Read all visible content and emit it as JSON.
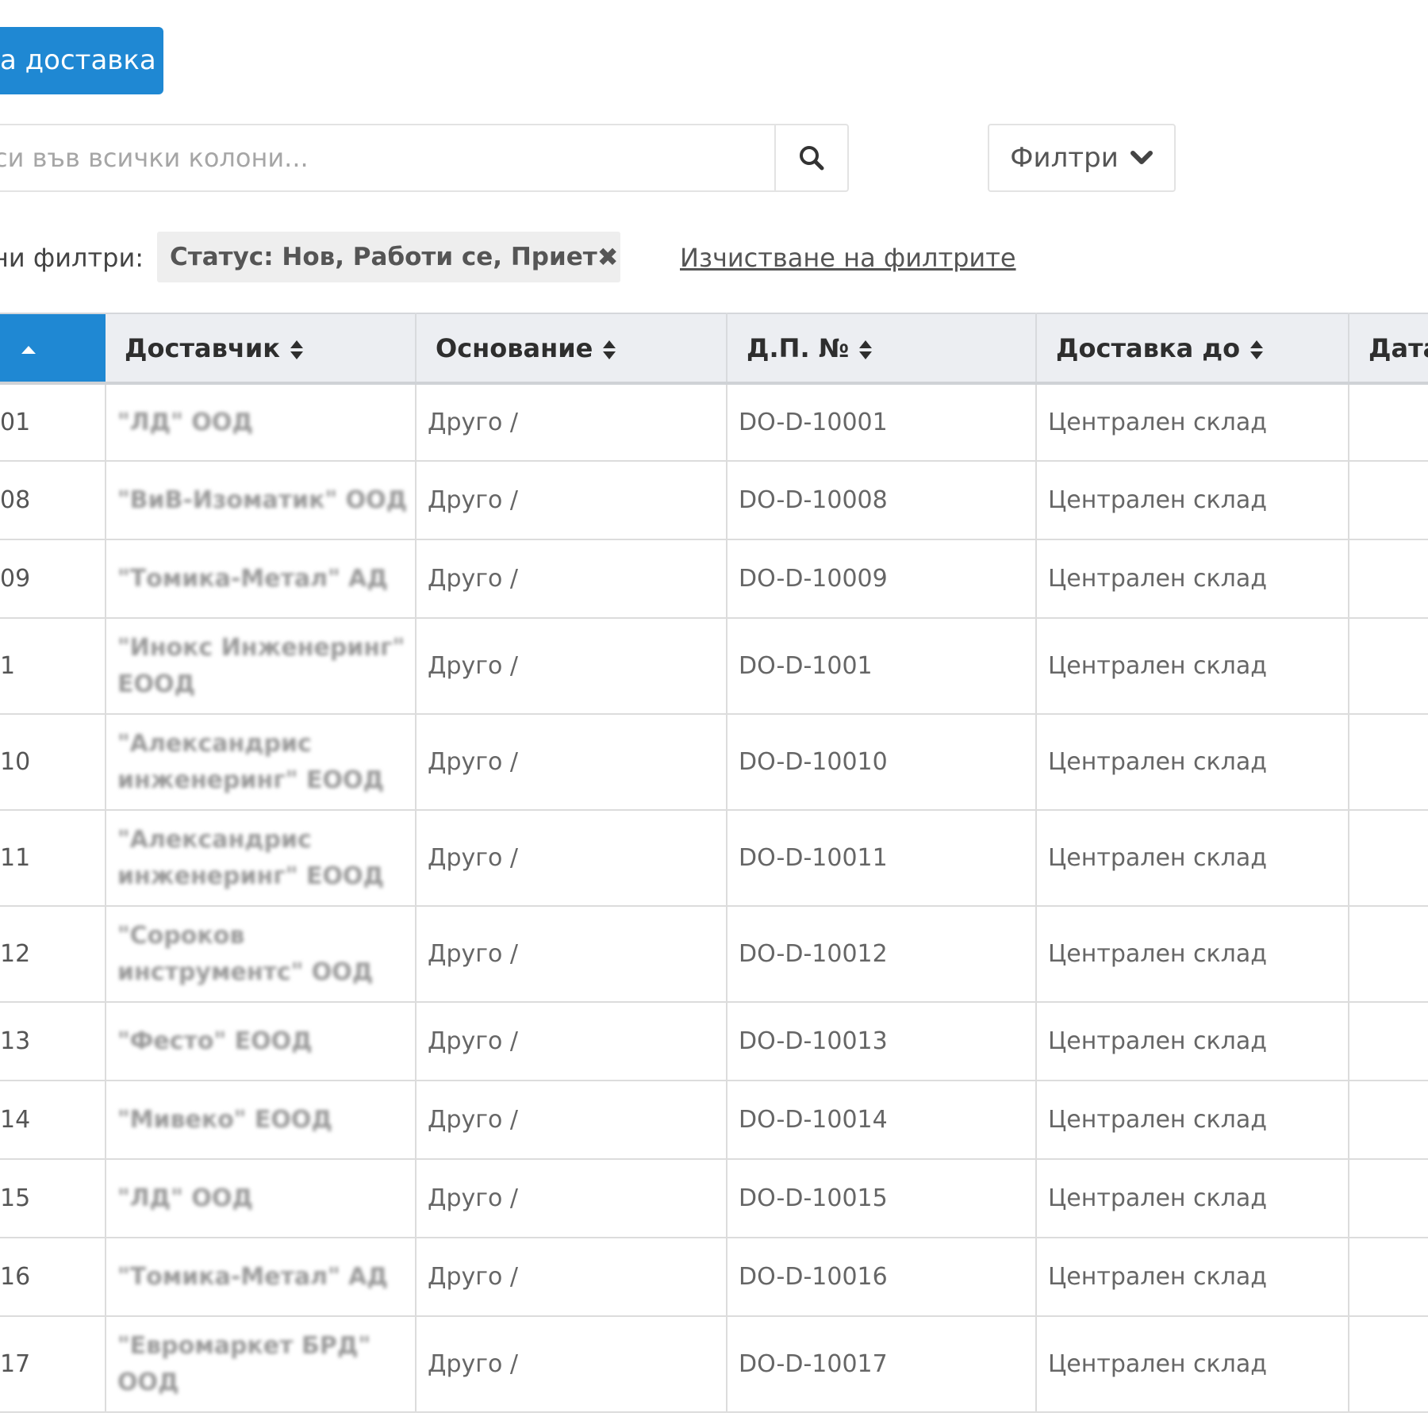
{
  "toolbar": {
    "new_delivery_label": "а доставка"
  },
  "search": {
    "placeholder": "си във всички колони..."
  },
  "filters": {
    "button_label": "Филтри",
    "active_label": "ни филтри:",
    "chip_label": "Статус: Нов, Работи се, Приет",
    "chip_close": "✖",
    "clear_label": "Изчистване на филтрите"
  },
  "table": {
    "columns": [
      {
        "label": "",
        "sorted": "asc"
      },
      {
        "label": "Доставчик"
      },
      {
        "label": "Основание"
      },
      {
        "label": "Д.П. №"
      },
      {
        "label": "Доставка до"
      },
      {
        "label": "Дата"
      }
    ],
    "rows": [
      {
        "num": "01",
        "supplier": "\"ЛД\" ООД",
        "basis": "Друго /",
        "doc": "DO-D-10001",
        "dest": "Централен склад"
      },
      {
        "num": "08",
        "supplier": "\"ВиВ-Изоматик\" ООД",
        "basis": "Друго /",
        "doc": "DO-D-10008",
        "dest": "Централен склад"
      },
      {
        "num": "09",
        "supplier": "\"Томика-Метал\" АД",
        "basis": "Друго /",
        "doc": "DO-D-10009",
        "dest": "Централен склад"
      },
      {
        "num": "1",
        "supplier": "\"Инокс Инженеринг\" ЕООД",
        "basis": "Друго /",
        "doc": "DO-D-1001",
        "dest": "Централен склад"
      },
      {
        "num": "10",
        "supplier": "\"Александрис инженеринг\" ЕООД",
        "basis": "Друго /",
        "doc": "DO-D-10010",
        "dest": "Централен склад"
      },
      {
        "num": "11",
        "supplier": "\"Александрис инженеринг\" ЕООД",
        "basis": "Друго /",
        "doc": "DO-D-10011",
        "dest": "Централен склад"
      },
      {
        "num": "12",
        "supplier": "\"Сороков инструментс\" ООД",
        "basis": "Друго /",
        "doc": "DO-D-10012",
        "dest": "Централен склад"
      },
      {
        "num": "13",
        "supplier": "\"Фесто\" ЕООД",
        "basis": "Друго /",
        "doc": "DO-D-10013",
        "dest": "Централен склад"
      },
      {
        "num": "14",
        "supplier": "\"Мивеко\" ЕООД",
        "basis": "Друго /",
        "doc": "DO-D-10014",
        "dest": "Централен склад"
      },
      {
        "num": "15",
        "supplier": "\"ЛД\" ООД",
        "basis": "Друго /",
        "doc": "DO-D-10015",
        "dest": "Централен склад"
      },
      {
        "num": "16",
        "supplier": "\"Томика-Метал\" АД",
        "basis": "Друго /",
        "doc": "DO-D-10016",
        "dest": "Централен склад"
      },
      {
        "num": "17",
        "supplier": "\"Евромаркет БРД\" ООД",
        "basis": "Друго /",
        "doc": "DO-D-10017",
        "dest": "Централен склад"
      }
    ]
  },
  "colors": {
    "accent": "#1f88d3",
    "header_bg": "#eceef2",
    "chip_bg": "#eeeeee"
  },
  "icons": {
    "search": "search-icon",
    "chevron": "chevron-down-icon",
    "sort": "sort-icon",
    "close": "close-icon"
  }
}
